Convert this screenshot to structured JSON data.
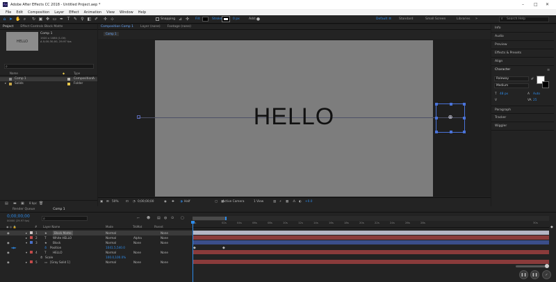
{
  "app": {
    "title": "Adobe After Effects CC 2018 - Untitled Project.aep *",
    "logo": "Ae"
  },
  "window_controls": {
    "minimize": "–",
    "maximize": "□",
    "close": "✕"
  },
  "menu": [
    "File",
    "Edit",
    "Composition",
    "Layer",
    "Effect",
    "Animation",
    "View",
    "Window",
    "Help"
  ],
  "toolbar": {
    "snapping_label": "Snapping",
    "fill_label": "Fill:",
    "stroke_label": "Stroke:",
    "stroke_width": "0 px",
    "add_label": "Add:",
    "workspaces": [
      "Default",
      "Standard",
      "Small Screen",
      "Libraries"
    ],
    "search_placeholder": "Search Help"
  },
  "project_panel": {
    "tabs": [
      "Project",
      "Effect Controls Block Matte"
    ],
    "comp_name": "Comp 1",
    "comp_info_1": "1920 x 1080 (1.00)",
    "comp_info_2": "Δ 0;00;30;00, 29.97 fps",
    "thumb_text": "HELLO",
    "search_placeholder": "",
    "col_name": "Name",
    "col_type": "Type",
    "items": [
      {
        "name": "Comp 1",
        "type": "Composition",
        "color": "#b9b7b1"
      },
      {
        "name": "Solids",
        "type": "Folder",
        "color": "#e8c84a"
      }
    ],
    "bpc": "8 bpc"
  },
  "viewer": {
    "tabs": [
      "Composition Comp 1",
      "Layer (none)",
      "Footage (none)"
    ],
    "breadcrumb": "Comp 1",
    "canvas_text": "HELLO",
    "zoom": "50%",
    "timecode": "0;00;00;00",
    "resolution": "Half",
    "camera": "Active Camera",
    "views": "1 View",
    "exposure": "+0.0"
  },
  "right_panels": [
    "Info",
    "Audio",
    "Preview",
    "Effects & Presets",
    "Align",
    "Character",
    "Paragraph",
    "Tracker",
    "Wiggler"
  ],
  "character": {
    "font": "Raleway",
    "style": "Medium",
    "size": "48 px",
    "leading": "Auto",
    "tracking": "25"
  },
  "timeline": {
    "tabs": [
      "Render Queue",
      "Comp 1"
    ],
    "timecode": "0;00;00;00",
    "timecode_sub": "00000 (29.97 fps)",
    "search_placeholder": "",
    "col_layer_name": "Layer Name",
    "col_mode": "Mode",
    "col_trkmat": "TrkMat",
    "col_parent": "Parent",
    "ruler": [
      "0s",
      "02s",
      "04s",
      "06s",
      "08s",
      "10s",
      "12s",
      "14s",
      "16s",
      "18s",
      "20s",
      "22s",
      "24s",
      "26s",
      "28s",
      "30s"
    ],
    "layers": [
      {
        "num": "1",
        "name": "Block Matte",
        "mode": "Normal",
        "trkmat": "",
        "parent": "None",
        "color": "#d0c8c8",
        "selected": true,
        "bar": "#b4b5c4"
      },
      {
        "num": "2",
        "name": "White HELLO",
        "mode": "Normal",
        "trkmat": "Alpha",
        "parent": "None",
        "color": "#c34a4a",
        "selected": false,
        "bar": "#8a3b3b"
      },
      {
        "num": "3",
        "name": "Block",
        "mode": "Normal",
        "trkmat": "None",
        "parent": "None",
        "color": "#4a70c9",
        "selected": false,
        "bar": "#3b4e8a"
      },
      {
        "num": "",
        "name": "Position",
        "mode": "1041.5,540.0",
        "trkmat": "",
        "parent": "",
        "color": "",
        "selected": false,
        "bar": ""
      },
      {
        "num": "4",
        "name": "HELLO",
        "mode": "Normal",
        "trkmat": "None",
        "parent": "None",
        "color": "#c34a4a",
        "selected": false,
        "bar": "#8a3b3b"
      },
      {
        "num": "",
        "name": "Scale",
        "mode": "100.0,100.0%",
        "trkmat": "",
        "parent": "",
        "color": "",
        "selected": false,
        "bar": ""
      },
      {
        "num": "5",
        "name": "[Gray Solid 1]",
        "mode": "Normal",
        "trkmat": "None",
        "parent": "None",
        "color": "#c34a4a",
        "selected": false,
        "bar": "#8a3b3b"
      }
    ],
    "toggle_label": "Toggle Switches / Modes"
  },
  "colors": {
    "accent": "#2d8ceb",
    "canvas": "#7d7d7d",
    "selection": "#4a73d9"
  }
}
